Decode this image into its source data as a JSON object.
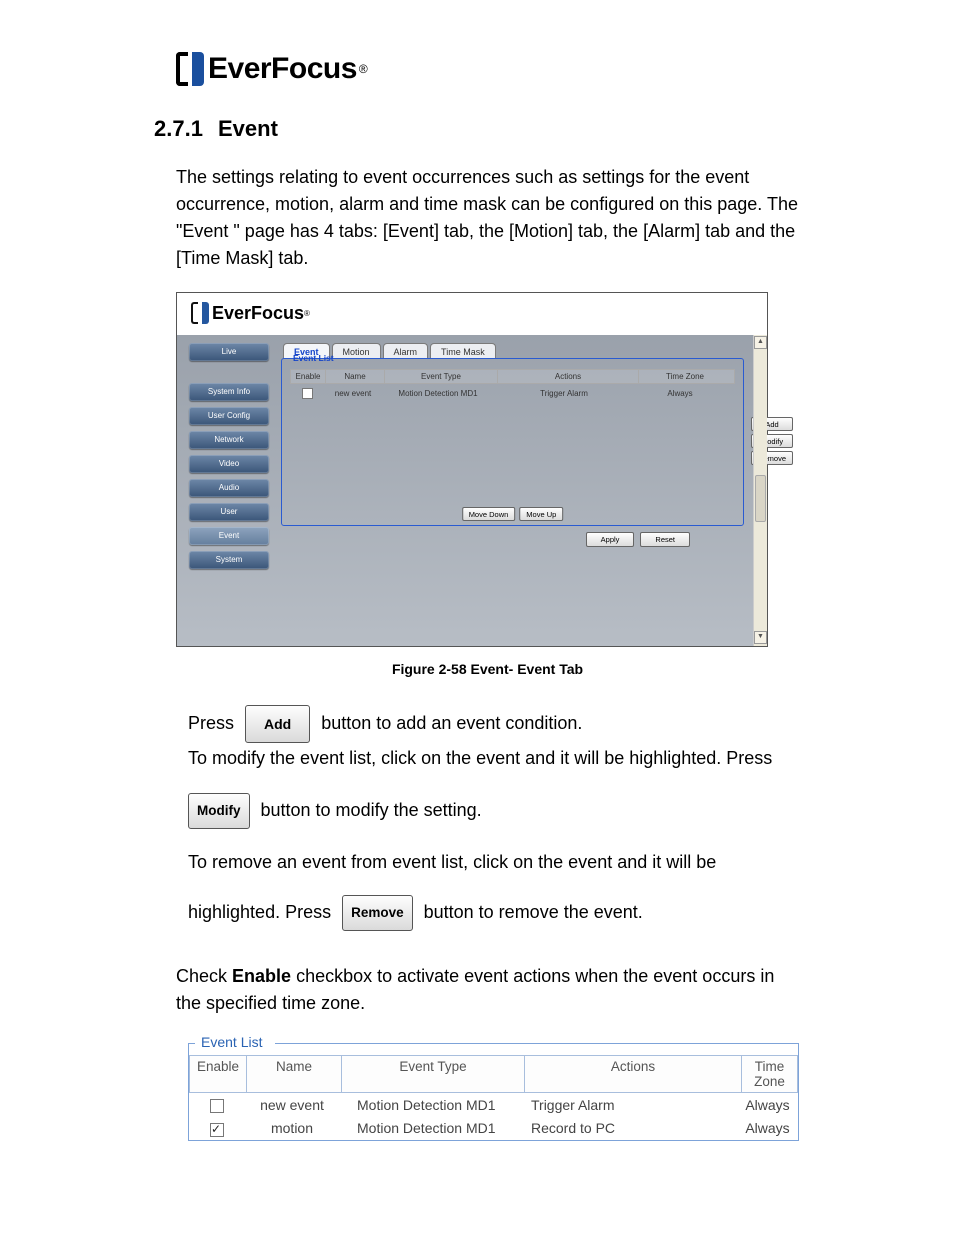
{
  "section_number": "2.7.1",
  "section_title": "Event",
  "brand": "EverFocus",
  "intro": "The settings relating to event occurrences such as settings for the event occurrence, motion, alarm and time mask can be configured on this page. The \"Event \" page has 4 tabs: [Event] tab, the [Motion] tab, the [Alarm] tab and the [Time Mask] tab.",
  "figure": {
    "caption": "Figure 2-58 Event- Event Tab",
    "sidebar": [
      "Live",
      "System Info",
      "User Config",
      "Network",
      "Video",
      "Audio",
      "User",
      "Event",
      "System"
    ],
    "tabs": [
      "Event",
      "Motion",
      "Alarm",
      "Time Mask"
    ],
    "active_tab": "Event",
    "panel_title": "Event List",
    "columns": {
      "enable": "Enable",
      "name": "Name",
      "event_type": "Event Type",
      "actions": "Actions",
      "time_zone": "Time Zone"
    },
    "row": {
      "enabled": false,
      "name": "new event",
      "event_type": "Motion Detection MD1",
      "actions": "Trigger Alarm",
      "time_zone": "Always"
    },
    "side_buttons": {
      "add": "Add",
      "modify": "Modify",
      "remove": "Remove"
    },
    "bottom_buttons": {
      "move_down": "Move Down",
      "move_up": "Move Up"
    },
    "below_buttons": {
      "apply": "Apply",
      "reset": "Reset"
    }
  },
  "instr": {
    "press": "Press ",
    "add": "Add",
    "after_add": " button to add an event condition.",
    "modify_line1": "To modify the event list, click on the event and it will be highlighted. Press",
    "modify": "Modify",
    "after_modify": " button to modify the setting.",
    "remove_line1": "To remove an event from event list, click on the event and it will be",
    "remove_line2_a": "highlighted. Press ",
    "remove": "Remove",
    "remove_line2_b": " button to remove the event.",
    "enable_para_a": "Check ",
    "enable_word": "Enable",
    "enable_para_b": " checkbox to activate event actions when the event occurs in the specified time zone."
  },
  "event_list2": {
    "legend": "Event List",
    "columns": {
      "enable": "Enable",
      "name": "Name",
      "event_type": "Event Type",
      "actions": "Actions",
      "time_zone": "Time Zone"
    },
    "rows": [
      {
        "enabled": false,
        "name": "new event",
        "event_type": "Motion Detection MD1",
        "actions": "Trigger Alarm",
        "time_zone": "Always"
      },
      {
        "enabled": true,
        "name": "motion",
        "event_type": "Motion Detection MD1",
        "actions": "Record to PC",
        "time_zone": "Always"
      }
    ]
  }
}
